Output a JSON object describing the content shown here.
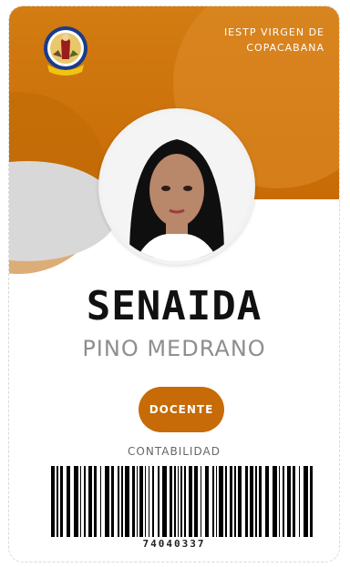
{
  "card": {
    "institution": "IESTP VIRGEN DE COPACABANA",
    "logo_icon": "school-crest-icon",
    "logo_banner": "ESPINAR",
    "first_name": "SENAIDA",
    "last_name": "PINO MEDRANO",
    "role": "DOCENTE",
    "department": "CONTABILIDAD",
    "barcode_number": "74040337"
  },
  "colors": {
    "accent": "#c86b06",
    "accent_light": "#df8c2a",
    "gray": "#d8d8d8"
  }
}
